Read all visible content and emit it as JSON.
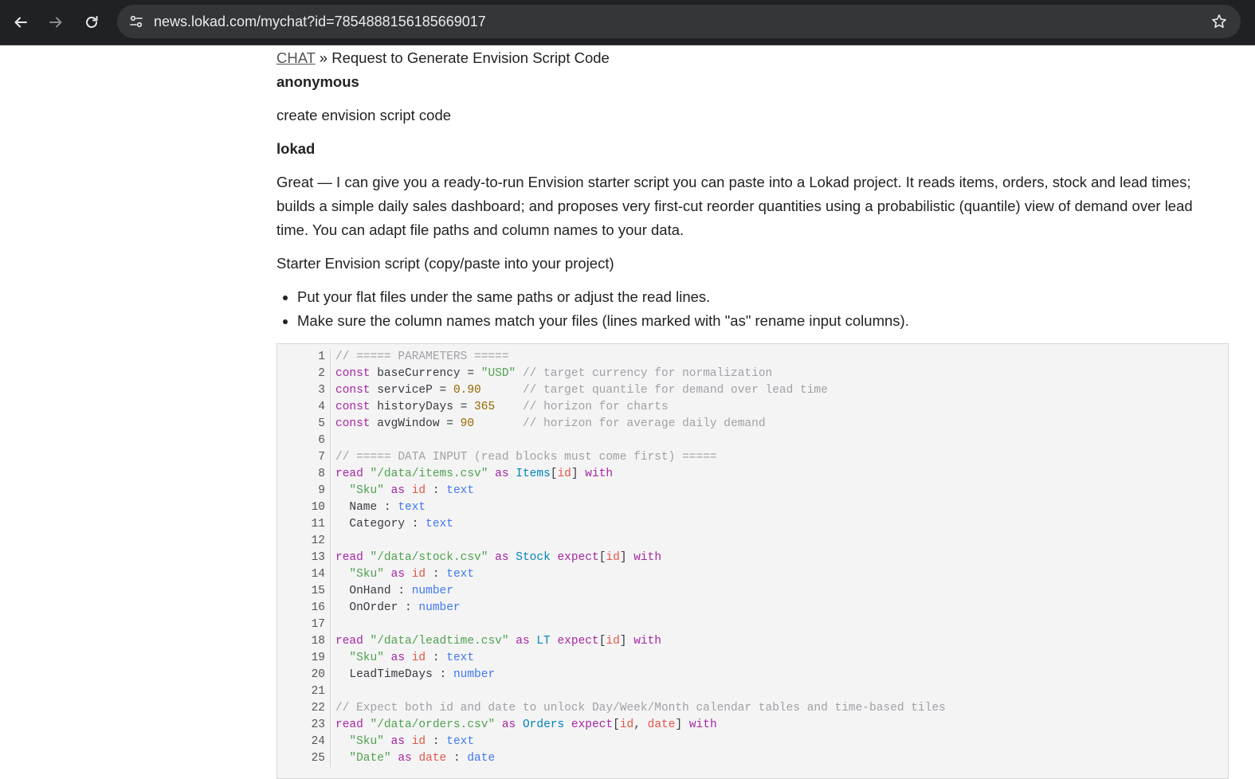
{
  "browser": {
    "url": "news.lokad.com/mychat?id=7854888156185669017"
  },
  "breadcrumb": {
    "link": "CHAT",
    "separator": " » ",
    "title": "Request to Generate Envision Script Code"
  },
  "conversation": {
    "user_name": "anonymous",
    "user_message": "create envision script code",
    "assistant_name": "lokad",
    "assistant_intro": "Great — I can give you a ready-to-run Envision starter script you can paste into a Lokad project. It reads items, orders, stock and lead times; builds a simple daily sales dashboard; and proposes very first-cut reorder quantities using a probabilistic (quantile) view of demand over lead time. You can adapt file paths and column names to your data.",
    "section_heading": "Starter Envision script (copy/paste into your project)",
    "bullets": [
      "Put your flat files under the same paths or adjust the read lines.",
      "Make sure the column names match your files (lines marked with \"as\" rename input columns)."
    ]
  },
  "code": {
    "colors": {
      "keyword": "#a626a4",
      "string": "#50a14f",
      "number": "#986801",
      "comment": "#a0a1a7",
      "type": "#4078f2",
      "table": "#0184bc",
      "identifier": "#e45649"
    },
    "lines": [
      [
        [
          "com",
          "// ===== PARAMETERS ====="
        ]
      ],
      [
        [
          "kw",
          "const"
        ],
        [
          "plain",
          " baseCurrency = "
        ],
        [
          "str",
          "\"USD\""
        ],
        [
          "plain",
          " "
        ],
        [
          "com",
          "// target currency for normalization"
        ]
      ],
      [
        [
          "kw",
          "const"
        ],
        [
          "plain",
          " serviceP = "
        ],
        [
          "num",
          "0.90"
        ],
        [
          "plain",
          "      "
        ],
        [
          "com",
          "// target quantile for demand over lead time"
        ]
      ],
      [
        [
          "kw",
          "const"
        ],
        [
          "plain",
          " historyDays = "
        ],
        [
          "num",
          "365"
        ],
        [
          "plain",
          "    "
        ],
        [
          "com",
          "// horizon for charts"
        ]
      ],
      [
        [
          "kw",
          "const"
        ],
        [
          "plain",
          " avgWindow = "
        ],
        [
          "num",
          "90"
        ],
        [
          "plain",
          "       "
        ],
        [
          "com",
          "// horizon for average daily demand"
        ]
      ],
      [],
      [
        [
          "com",
          "// ===== DATA INPUT (read blocks must come first) ====="
        ]
      ],
      [
        [
          "kw",
          "read"
        ],
        [
          "plain",
          " "
        ],
        [
          "str",
          "\"/data/items.csv\""
        ],
        [
          "plain",
          " "
        ],
        [
          "kw",
          "as"
        ],
        [
          "plain",
          " "
        ],
        [
          "tbl",
          "Items"
        ],
        [
          "plain",
          "["
        ],
        [
          "id",
          "id"
        ],
        [
          "plain",
          "] "
        ],
        [
          "kw",
          "with"
        ]
      ],
      [
        [
          "plain",
          "  "
        ],
        [
          "str",
          "\"Sku\""
        ],
        [
          "plain",
          " "
        ],
        [
          "kw",
          "as"
        ],
        [
          "plain",
          " "
        ],
        [
          "id",
          "id"
        ],
        [
          "plain",
          " : "
        ],
        [
          "type",
          "text"
        ]
      ],
      [
        [
          "plain",
          "  Name : "
        ],
        [
          "type",
          "text"
        ]
      ],
      [
        [
          "plain",
          "  Category : "
        ],
        [
          "type",
          "text"
        ]
      ],
      [],
      [
        [
          "kw",
          "read"
        ],
        [
          "plain",
          " "
        ],
        [
          "str",
          "\"/data/stock.csv\""
        ],
        [
          "plain",
          " "
        ],
        [
          "kw",
          "as"
        ],
        [
          "plain",
          " "
        ],
        [
          "tbl",
          "Stock"
        ],
        [
          "plain",
          " "
        ],
        [
          "kw",
          "expect"
        ],
        [
          "plain",
          "["
        ],
        [
          "id",
          "id"
        ],
        [
          "plain",
          "] "
        ],
        [
          "kw",
          "with"
        ]
      ],
      [
        [
          "plain",
          "  "
        ],
        [
          "str",
          "\"Sku\""
        ],
        [
          "plain",
          " "
        ],
        [
          "kw",
          "as"
        ],
        [
          "plain",
          " "
        ],
        [
          "id",
          "id"
        ],
        [
          "plain",
          " : "
        ],
        [
          "type",
          "text"
        ]
      ],
      [
        [
          "plain",
          "  OnHand : "
        ],
        [
          "type",
          "number"
        ]
      ],
      [
        [
          "plain",
          "  OnOrder : "
        ],
        [
          "type",
          "number"
        ]
      ],
      [],
      [
        [
          "kw",
          "read"
        ],
        [
          "plain",
          " "
        ],
        [
          "str",
          "\"/data/leadtime.csv\""
        ],
        [
          "plain",
          " "
        ],
        [
          "kw",
          "as"
        ],
        [
          "plain",
          " "
        ],
        [
          "tbl",
          "LT"
        ],
        [
          "plain",
          " "
        ],
        [
          "kw",
          "expect"
        ],
        [
          "plain",
          "["
        ],
        [
          "id",
          "id"
        ],
        [
          "plain",
          "] "
        ],
        [
          "kw",
          "with"
        ]
      ],
      [
        [
          "plain",
          "  "
        ],
        [
          "str",
          "\"Sku\""
        ],
        [
          "plain",
          " "
        ],
        [
          "kw",
          "as"
        ],
        [
          "plain",
          " "
        ],
        [
          "id",
          "id"
        ],
        [
          "plain",
          " : "
        ],
        [
          "type",
          "text"
        ]
      ],
      [
        [
          "plain",
          "  LeadTimeDays : "
        ],
        [
          "type",
          "number"
        ]
      ],
      [],
      [
        [
          "com",
          "// Expect both id and date to unlock Day/Week/Month calendar tables and time-based tiles"
        ]
      ],
      [
        [
          "kw",
          "read"
        ],
        [
          "plain",
          " "
        ],
        [
          "str",
          "\"/data/orders.csv\""
        ],
        [
          "plain",
          " "
        ],
        [
          "kw",
          "as"
        ],
        [
          "plain",
          " "
        ],
        [
          "tbl",
          "Orders"
        ],
        [
          "plain",
          " "
        ],
        [
          "kw",
          "expect"
        ],
        [
          "plain",
          "["
        ],
        [
          "id",
          "id"
        ],
        [
          "plain",
          ", "
        ],
        [
          "id",
          "date"
        ],
        [
          "plain",
          "] "
        ],
        [
          "kw",
          "with"
        ]
      ],
      [
        [
          "plain",
          "  "
        ],
        [
          "str",
          "\"Sku\""
        ],
        [
          "plain",
          " "
        ],
        [
          "kw",
          "as"
        ],
        [
          "plain",
          " "
        ],
        [
          "id",
          "id"
        ],
        [
          "plain",
          " : "
        ],
        [
          "type",
          "text"
        ]
      ],
      [
        [
          "plain",
          "  "
        ],
        [
          "str",
          "\"Date\""
        ],
        [
          "plain",
          " "
        ],
        [
          "kw",
          "as"
        ],
        [
          "plain",
          " "
        ],
        [
          "id",
          "date"
        ],
        [
          "plain",
          " : "
        ],
        [
          "type",
          "date"
        ]
      ]
    ]
  }
}
